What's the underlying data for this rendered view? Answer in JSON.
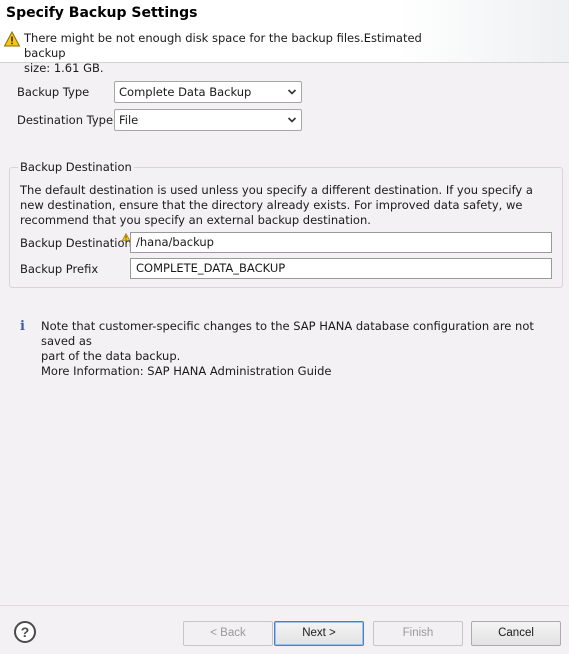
{
  "header": {
    "title": "Specify Backup Settings",
    "warning_line1": "There might be not enough disk space for the backup files.Estimated backup",
    "warning_line2": "size: 1.61 GB."
  },
  "form": {
    "backup_type_label": "Backup Type",
    "backup_type_value": "Complete Data Backup",
    "destination_type_label": "Destination Type",
    "destination_type_value": "File"
  },
  "backup_destination": {
    "group_title": "Backup Destination",
    "description": "The default destination is used unless you specify a different destination. If you specify a new destination, ensure that the directory already exists. For improved data safety, we recommend that you specify an external backup destination.",
    "destination_label": "Backup Destination",
    "destination_value": "/hana/backup",
    "prefix_label": "Backup Prefix",
    "prefix_value": "COMPLETE_DATA_BACKUP"
  },
  "note": {
    "line1": "Note that customer-specific changes to the SAP HANA database configuration are not saved as",
    "line2": "part of the data backup.",
    "line3": "More Information: SAP HANA Administration Guide"
  },
  "footer": {
    "help_label": "?",
    "back_label": "< Back",
    "next_label": "Next >",
    "finish_label": "Finish",
    "cancel_label": "Cancel"
  },
  "colors": {
    "warning_yellow": "#f5c518",
    "info_blue": "#3b5fa0",
    "default_button_border": "#4a7fc1"
  },
  "icons": {
    "warning": "warning-triangle-icon",
    "info": "info-icon",
    "dropdown": "chevron-down-icon",
    "help": "help-icon"
  }
}
